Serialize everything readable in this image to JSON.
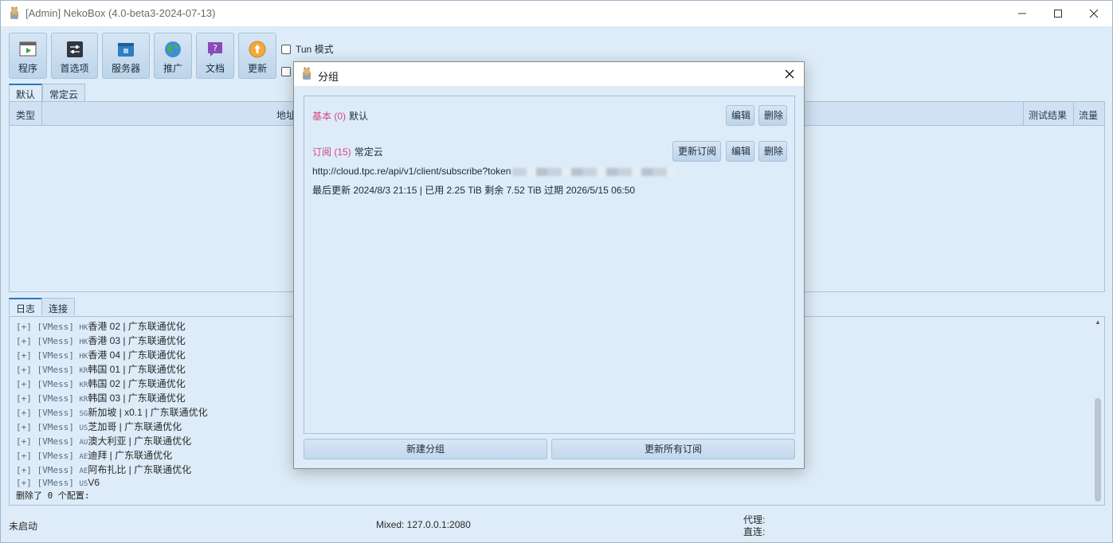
{
  "window": {
    "title": "[Admin] NekoBox (4.0-beta3-2024-07-13)"
  },
  "toolbar": {
    "buttons": [
      {
        "label": "程序",
        "icon": "program-icon"
      },
      {
        "label": "首选项",
        "icon": "preferences-icon"
      },
      {
        "label": "服务器",
        "icon": "server-icon"
      },
      {
        "label": "推广",
        "icon": "globe-icon"
      },
      {
        "label": "文档",
        "icon": "help-doc-icon"
      },
      {
        "label": "更新",
        "icon": "update-icon"
      }
    ],
    "tun_label": "Tun 模式"
  },
  "group_tabs": [
    "默认",
    "常定云"
  ],
  "table": {
    "columns": [
      "类型",
      "地址",
      "测试结果",
      "流量"
    ]
  },
  "bottom_tabs": [
    "日志",
    "连接"
  ],
  "log": {
    "lines": [
      {
        "prefix": "[+] [VMess] ",
        "flag": "HK",
        "text": "香港 02 | 广东联通优化"
      },
      {
        "prefix": "[+] [VMess] ",
        "flag": "HK",
        "text": "香港 03 | 广东联通优化"
      },
      {
        "prefix": "[+] [VMess] ",
        "flag": "HK",
        "text": "香港 04 | 广东联通优化"
      },
      {
        "prefix": "[+] [VMess] ",
        "flag": "KR",
        "text": "韩国 01 | 广东联通优化"
      },
      {
        "prefix": "[+] [VMess] ",
        "flag": "KR",
        "text": "韩国 02 | 广东联通优化"
      },
      {
        "prefix": "[+] [VMess] ",
        "flag": "KR",
        "text": "韩国 03 | 广东联通优化"
      },
      {
        "prefix": "[+] [VMess] ",
        "flag": "SG",
        "text": "新加坡 | x0.1 | 广东联通优化"
      },
      {
        "prefix": "[+] [VMess] ",
        "flag": "US",
        "text": "芝加哥 | 广东联通优化"
      },
      {
        "prefix": "[+] [VMess] ",
        "flag": "AU",
        "text": "澳大利亚 | 广东联通优化"
      },
      {
        "prefix": "[+] [VMess] ",
        "flag": "AE",
        "text": "迪拜 | 广东联通优化"
      },
      {
        "prefix": "[+] [VMess] ",
        "flag": "AE",
        "text": "阿布扎比 | 广东联通优化"
      },
      {
        "prefix": "[+] [VMess] ",
        "flag": "US",
        "text": "V6"
      }
    ],
    "footer": "删除了 0 个配置:"
  },
  "statusbar": {
    "state": "未启动",
    "mixed": "Mixed: 127.0.0.1:2080",
    "proxy": "代理:",
    "direct": "直连:"
  },
  "dialog": {
    "title": "分组",
    "groups": [
      {
        "type": "基本 (0)",
        "name": "默认",
        "buttons": [
          "编辑",
          "删除"
        ]
      },
      {
        "type": "订阅 (15)",
        "name": "常定云",
        "buttons": [
          "更新订阅",
          "编辑",
          "删除"
        ],
        "url": "http://cloud.tpc.re/api/v1/client/subscribe?token",
        "info": "最后更新 2024/8/3 21:15 | 已用 2.25 TiB 剩余 7.52 TiB 过期 2026/5/15 06:50"
      }
    ],
    "new_group_label": "新建分组",
    "update_all_label": "更新所有订阅"
  }
}
